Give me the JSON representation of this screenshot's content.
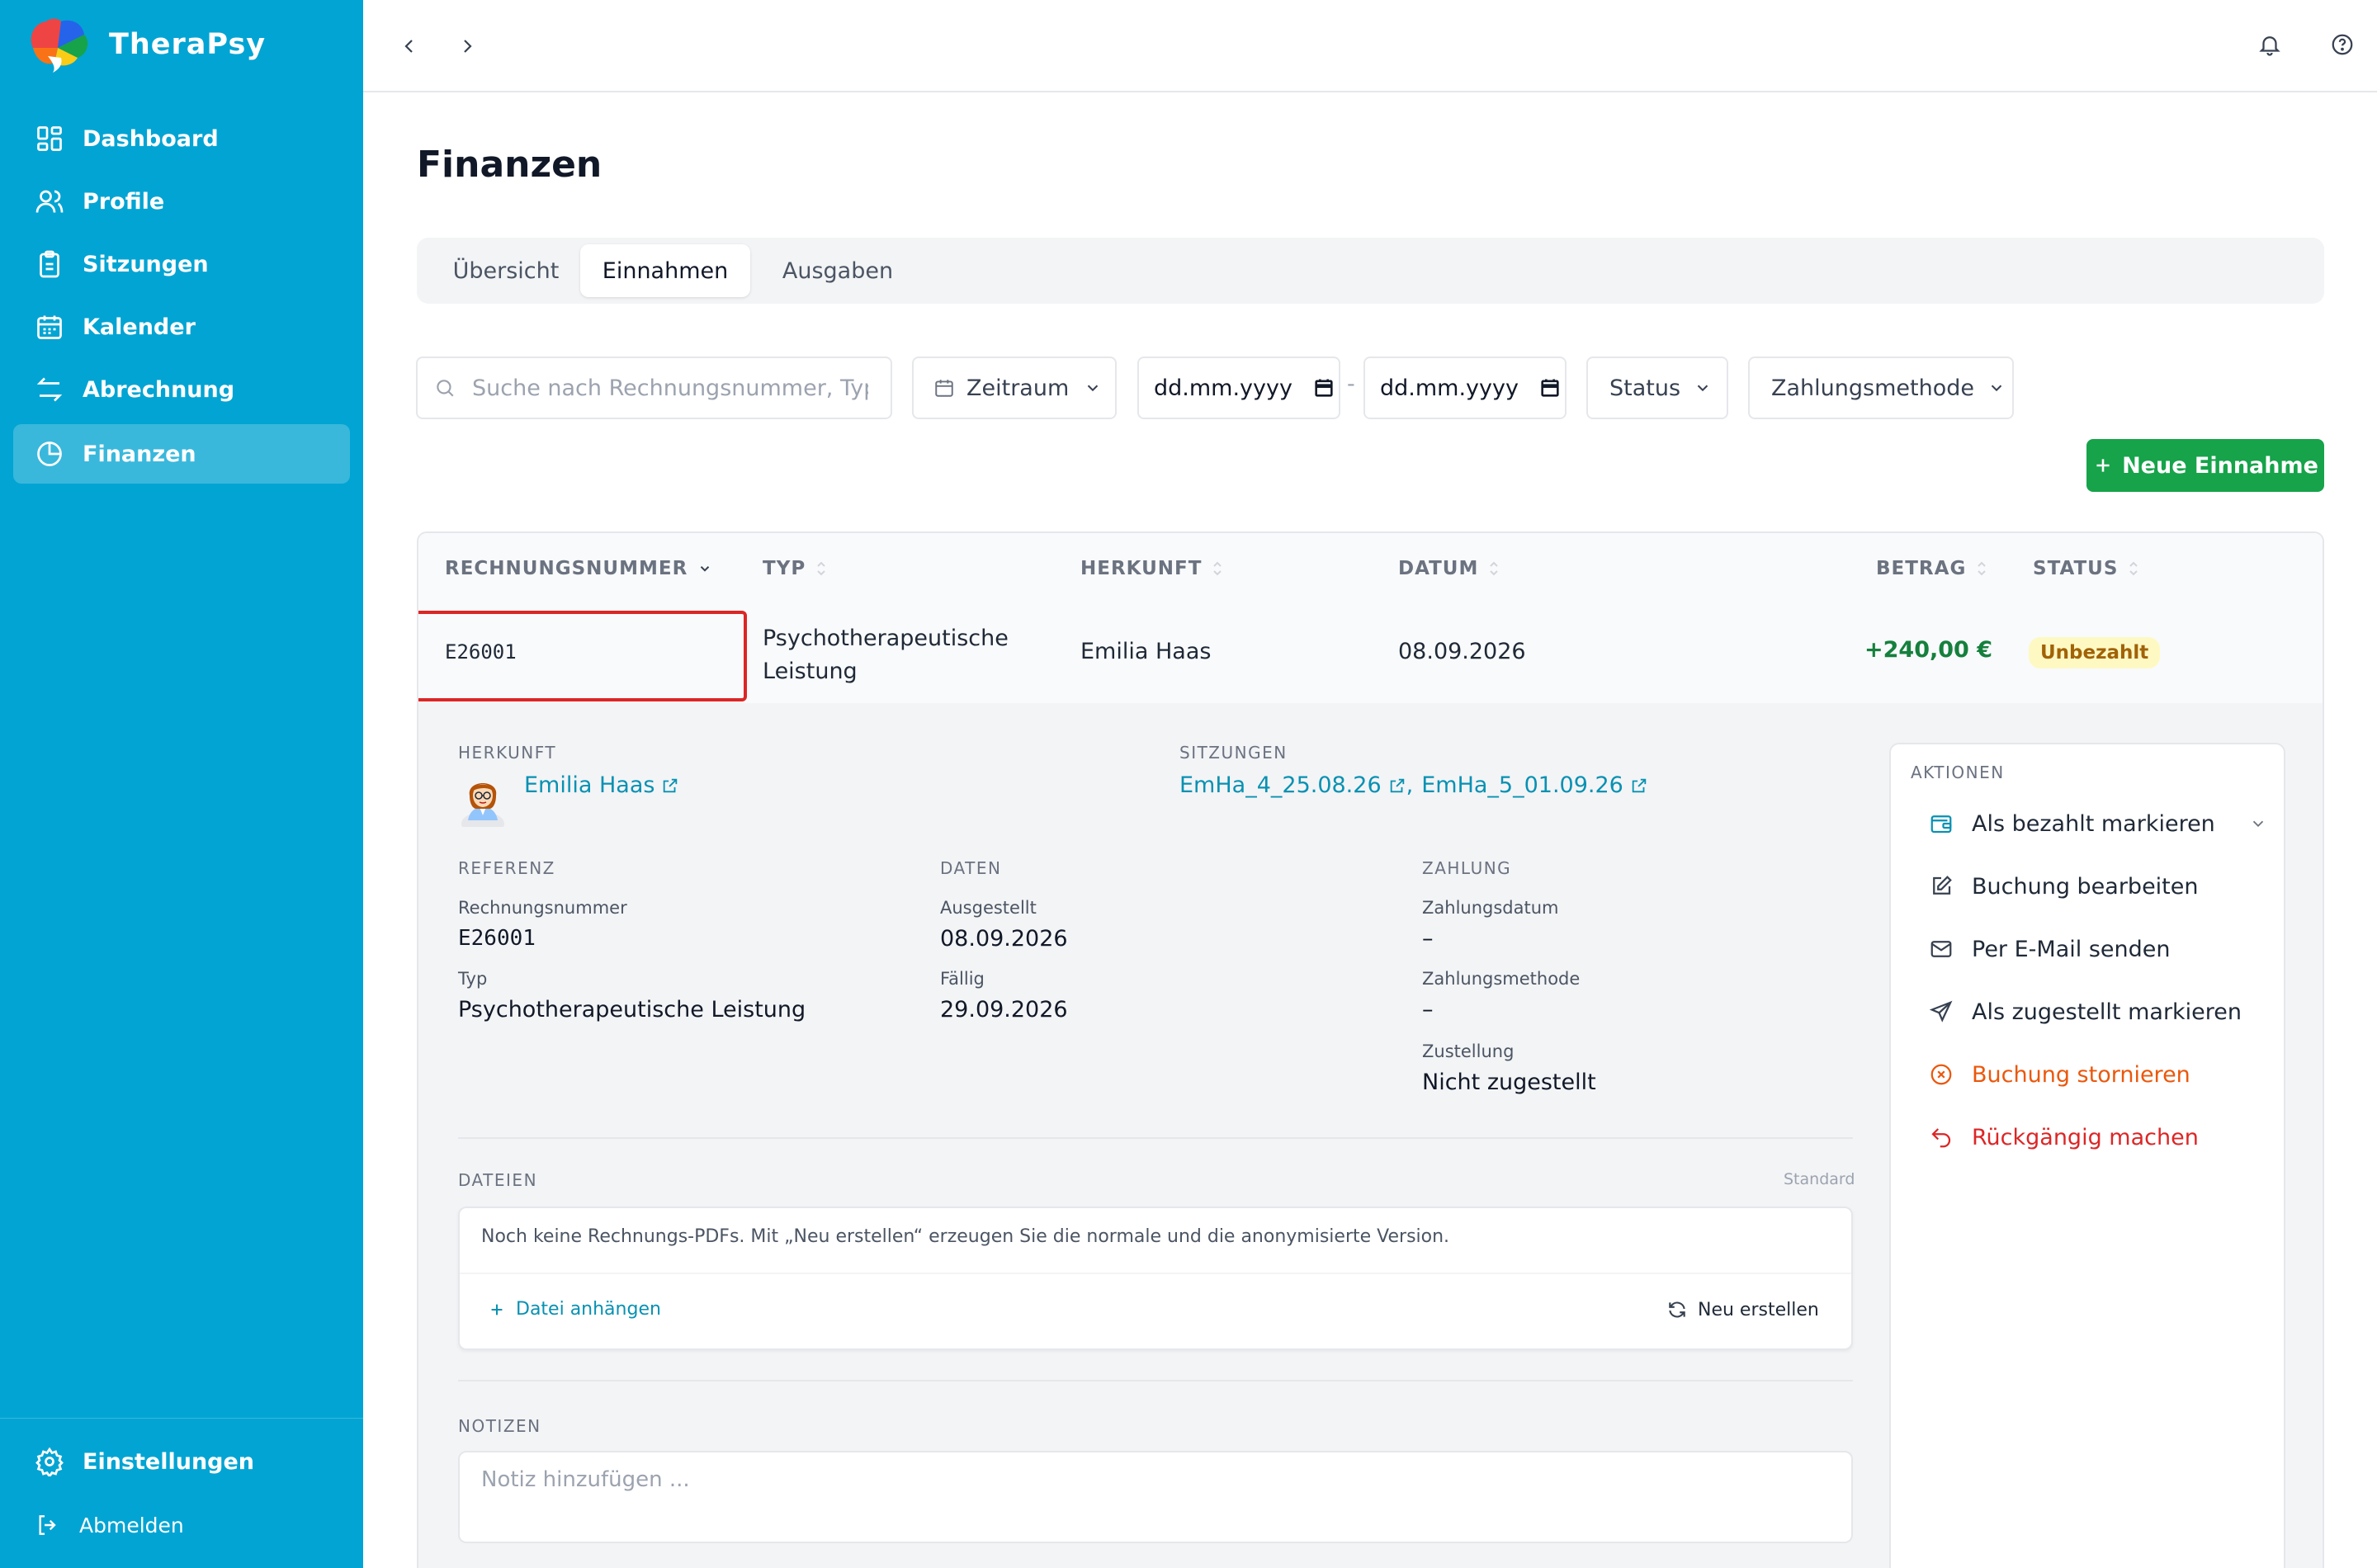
{
  "app": {
    "name": "TheraPsy"
  },
  "sidebar": {
    "items": [
      {
        "label": "Dashboard",
        "icon": "dashboard-icon"
      },
      {
        "label": "Profile",
        "icon": "users-icon"
      },
      {
        "label": "Sitzungen",
        "icon": "clipboard-icon"
      },
      {
        "label": "Kalender",
        "icon": "calendar-icon"
      },
      {
        "label": "Abrechnung",
        "icon": "arrows-icon"
      },
      {
        "label": "Finanzen",
        "icon": "pie-chart-icon",
        "active": true
      }
    ],
    "settings_label": "Einstellungen",
    "logout_label": "Abmelden"
  },
  "page": {
    "title": "Finanzen"
  },
  "tabs": [
    {
      "label": "Übersicht"
    },
    {
      "label": "Einnahmen",
      "active": true
    },
    {
      "label": "Ausgaben"
    }
  ],
  "filters": {
    "search_placeholder": "Suche nach Rechnungsnummer, Typ",
    "period_label": "Zeitraum",
    "date_from_placeholder": "dd.mm.yyyy",
    "date_separator": "-",
    "date_to_placeholder": "dd.mm.yyyy",
    "status_label": "Status",
    "payment_method_label": "Zahlungsmethode"
  },
  "new_income_label": "Neue Einnahme",
  "table": {
    "columns": [
      "RECHNUNGSNUMMER",
      "TYP",
      "HERKUNFT",
      "DATUM",
      "BETRAG",
      "STATUS"
    ],
    "row": {
      "invoice": "E26001",
      "type_line1": "Psychotherapeutische",
      "type_line2": "Leistung",
      "origin": "Emilia Haas",
      "date": "08.09.2026",
      "amount": "+240,00 €",
      "status": "Unbezahlt"
    }
  },
  "details": {
    "origin_label": "HERKUNFT",
    "origin_name": "Emilia Haas",
    "sessions_label": "SITZUNGEN",
    "session_1": "EmHa_4_25.08.26",
    "session_sep": ",",
    "session_2": "EmHa_5_01.09.26",
    "reference": {
      "label": "REFERENZ",
      "invoice_number_label": "Rechnungsnummer",
      "invoice_number": "E26001",
      "type_label": "Typ",
      "type": "Psychotherapeutische Leistung"
    },
    "dates": {
      "label": "DATEN",
      "issued_label": "Ausgestellt",
      "issued": "08.09.2026",
      "due_label": "Fällig",
      "due": "29.09.2026"
    },
    "payment": {
      "label": "ZAHLUNG",
      "date_label": "Zahlungsdatum",
      "date": "–",
      "method_label": "Zahlungsmethode",
      "method": "–",
      "delivery_label": "Zustellung",
      "delivery": "Nicht zugestellt"
    },
    "files": {
      "label": "DATEIEN",
      "standard_label": "Standard",
      "empty_text": "Noch keine Rechnungs-PDFs. Mit „Neu erstellen“ erzeugen Sie die normale und die anonymisierte Version.",
      "attach_label": "Datei anhängen",
      "regenerate_label": "Neu erstellen"
    },
    "notes": {
      "label": "NOTIZEN",
      "placeholder": "Notiz hinzufügen ..."
    }
  },
  "actions": {
    "label": "AKTIONEN",
    "mark_paid": "Als bezahlt markieren",
    "edit": "Buchung bearbeiten",
    "email": "Per E-Mail senden",
    "mark_delivered": "Als zugestellt markieren",
    "cancel": "Buchung stornieren",
    "undo": "Rückgängig machen"
  },
  "colors": {
    "sidebar": "#02a4d3",
    "accent": "#0891b2",
    "primary_button": "#16a34a",
    "amount_positive": "#15803d",
    "status_unpaid_bg": "#fef9c3",
    "status_unpaid_text": "#a16207",
    "danger": "#dc2626",
    "warning": "#ea580c"
  }
}
